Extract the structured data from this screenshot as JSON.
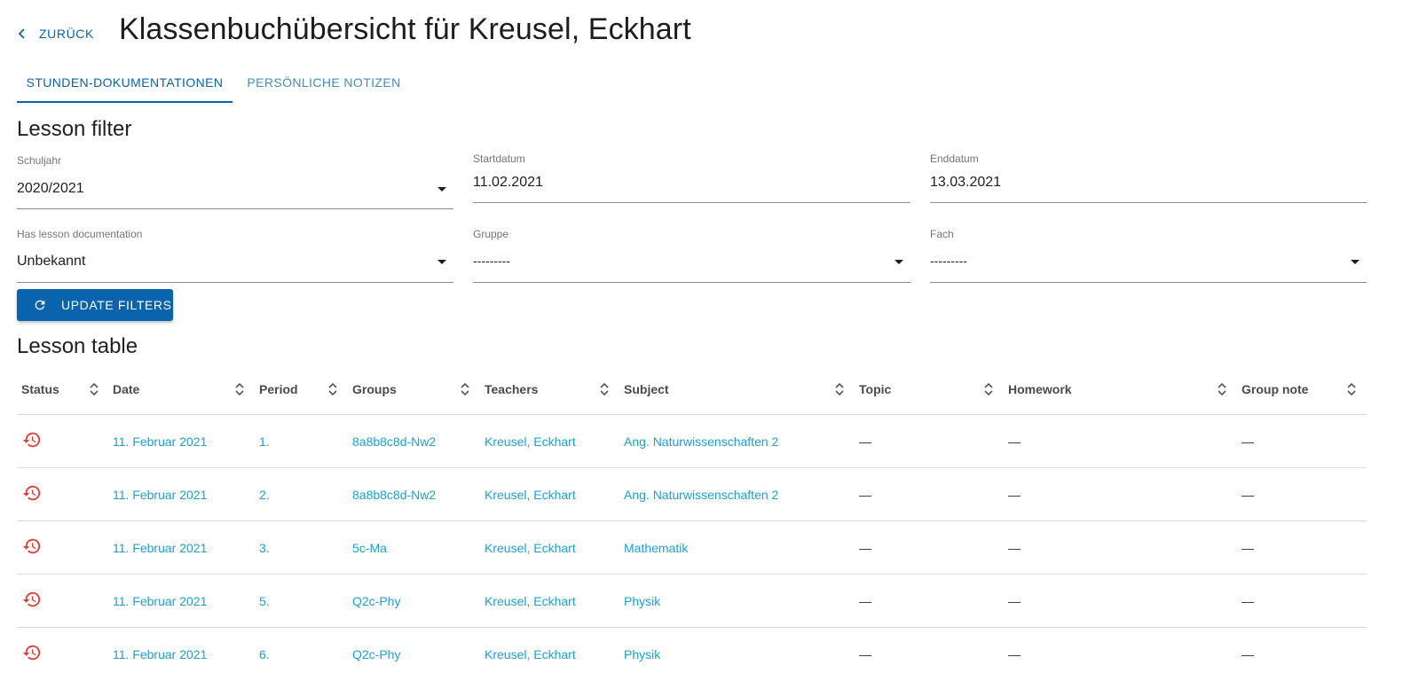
{
  "header": {
    "back_label": "ZURÜCK",
    "title": "Klassenbuchübersicht für Kreusel, Eckhart"
  },
  "tabs": [
    {
      "label": "STUNDEN-DOKUMENTATIONEN",
      "active": true
    },
    {
      "label": "PERSÖNLICHE NOTIZEN",
      "active": false
    }
  ],
  "filter": {
    "title": "Lesson filter",
    "schuljahr": {
      "label": "Schuljahr",
      "value": "2020/2021"
    },
    "startdatum": {
      "label": "Startdatum",
      "value": "11.02.2021"
    },
    "enddatum": {
      "label": "Enddatum",
      "value": "13.03.2021"
    },
    "has_doc": {
      "label": "Has lesson documentation",
      "value": "Unbekannt"
    },
    "gruppe": {
      "label": "Gruppe",
      "value": "---------"
    },
    "fach": {
      "label": "Fach",
      "value": "---------"
    },
    "update_label": "UPDATE FILTERS"
  },
  "table": {
    "title": "Lesson table",
    "columns": [
      "Status",
      "Date",
      "Period",
      "Groups",
      "Teachers",
      "Subject",
      "Topic",
      "Homework",
      "Group note"
    ],
    "rows": [
      {
        "status": "history-icon",
        "date": "11. Februar 2021",
        "period": "1.",
        "groups": "8a8b8c8d-Nw2",
        "teachers": "Kreusel, Eckhart",
        "subject": "Ang. Naturwissenschaften 2",
        "topic": "—",
        "homework": "—",
        "group_note": "—"
      },
      {
        "status": "history-icon",
        "date": "11. Februar 2021",
        "period": "2.",
        "groups": "8a8b8c8d-Nw2",
        "teachers": "Kreusel, Eckhart",
        "subject": "Ang. Naturwissenschaften 2",
        "topic": "—",
        "homework": "—",
        "group_note": "—"
      },
      {
        "status": "history-icon",
        "date": "11. Februar 2021",
        "period": "3.",
        "groups": "5c-Ma",
        "teachers": "Kreusel, Eckhart",
        "subject": "Mathematik",
        "topic": "—",
        "homework": "—",
        "group_note": "—"
      },
      {
        "status": "history-icon",
        "date": "11. Februar 2021",
        "period": "5.",
        "groups": "Q2c-Phy",
        "teachers": "Kreusel, Eckhart",
        "subject": "Physik",
        "topic": "—",
        "homework": "—",
        "group_note": "—"
      },
      {
        "status": "history-icon",
        "date": "11. Februar 2021",
        "period": "6.",
        "groups": "Q2c-Phy",
        "teachers": "Kreusel, Eckhart",
        "subject": "Physik",
        "topic": "—",
        "homework": "—",
        "group_note": "—"
      }
    ]
  },
  "colors": {
    "primary": "#0a63ad",
    "link": "#1aa0d8",
    "status_red": "#e53935"
  }
}
